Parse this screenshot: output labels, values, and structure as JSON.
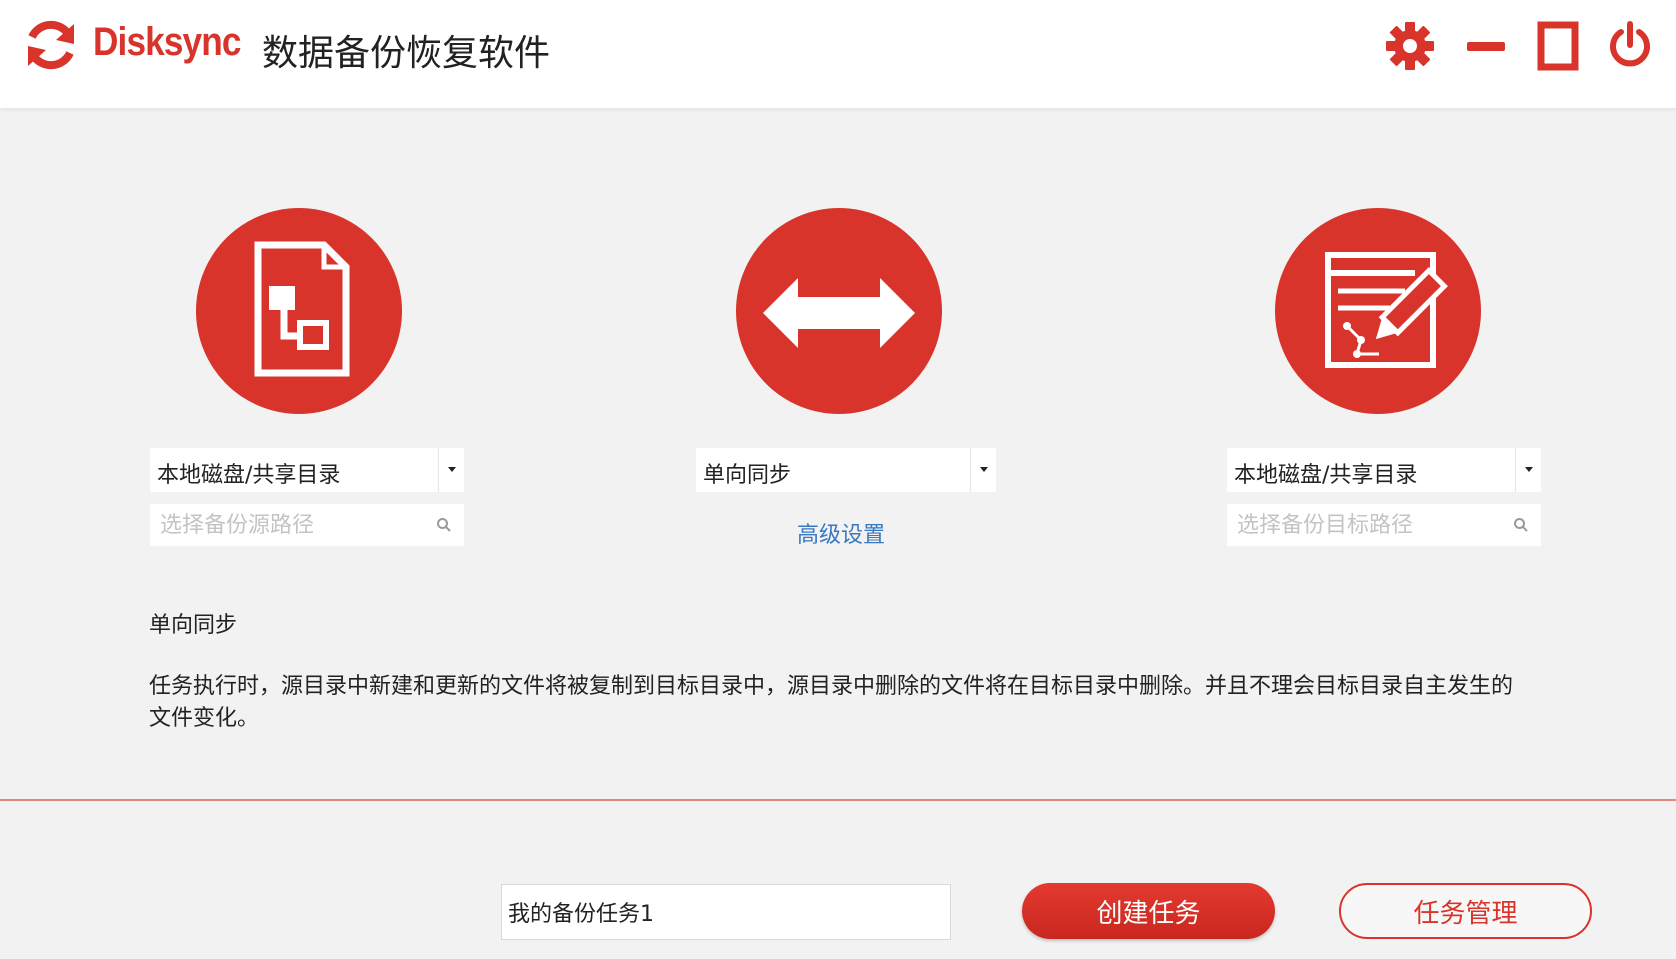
{
  "app": {
    "brand": "Disksync",
    "title": "数据备份恢复软件",
    "logo_icon": "sync-arrows-icon",
    "accent_color": "#d9342b"
  },
  "window_controls": [
    {
      "name": "settings",
      "icon": "gear-icon"
    },
    {
      "name": "minimize",
      "icon": "minimize-icon"
    },
    {
      "name": "maximize",
      "icon": "maximize-icon"
    },
    {
      "name": "close",
      "icon": "power-icon"
    }
  ],
  "source": {
    "icon": "source-document-icon",
    "type_select": "本地磁盘/共享目录",
    "path_placeholder": "选择备份源路径",
    "path_value": ""
  },
  "mode": {
    "icon": "double-arrow-icon",
    "select": "单向同步",
    "advanced_link": "高级设置"
  },
  "target": {
    "icon": "target-edit-icon",
    "type_select": "本地磁盘/共享目录",
    "path_placeholder": "选择备份目标路径",
    "path_value": ""
  },
  "description": {
    "heading": "单向同步",
    "text": "任务执行时，源目录中新建和更新的文件将被复制到目标目录中，源目录中删除的文件将在目标目录中删除。并且不理会目标目录自主发生的文件变化。"
  },
  "footer": {
    "task_name_value": "我的备份任务1",
    "create_button": "创建任务",
    "manage_button": "任务管理"
  }
}
